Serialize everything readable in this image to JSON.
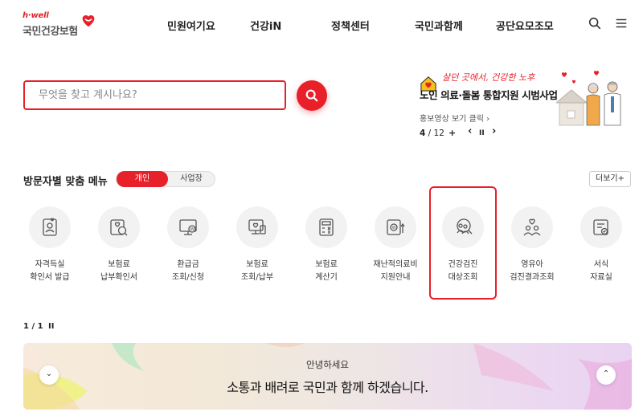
{
  "brand": {
    "sub": "h·well",
    "name": "국민건강보험",
    "accent": "#e8202a"
  },
  "nav": [
    "민원여기요",
    "건강iN",
    "정책센터",
    "국민과함께",
    "공단요모조모"
  ],
  "header_icons": [
    "search-icon",
    "menu-icon"
  ],
  "search": {
    "placeholder": "무엇을 찾고 계시나요?"
  },
  "banner": {
    "slogan": "살던 곳에서, 건강한 노후",
    "title": "노인 의료·돌봄 통합지원 시범사업",
    "link": "홍보영상 보기 클릭",
    "link_arrow": "›",
    "current": "4",
    "separator": " / ",
    "total": "12",
    "plus": "+",
    "prev": "‹",
    "pause": "II",
    "next": "›"
  },
  "menu": {
    "title": "방문자별 맞춤 메뉴",
    "toggle_on": "개인",
    "toggle_off": "사업장",
    "more": "더보기+"
  },
  "services": [
    {
      "line1": "자격득실",
      "line2": "확인서 발급",
      "icon": "id-card-icon"
    },
    {
      "line1": "보험료",
      "line2": "납부확인서",
      "icon": "payment-check-icon"
    },
    {
      "line1": "환급금",
      "line2": "조회/신청",
      "icon": "refund-monitor-icon"
    },
    {
      "line1": "보험료",
      "line2": "조회/납부",
      "icon": "pay-monitor-icon"
    },
    {
      "line1": "보험료",
      "line2": "계산기",
      "icon": "calculator-icon"
    },
    {
      "line1": "재난적의료비",
      "line2": "지원안내",
      "icon": "medical-support-icon"
    },
    {
      "line1": "건강검진",
      "line2": "대상조회",
      "icon": "checkup-people-icon"
    },
    {
      "line1": "영유아",
      "line2": "검진결과조회",
      "icon": "infant-checkup-icon"
    },
    {
      "line1": "서식",
      "line2": "자료실",
      "icon": "document-icon"
    }
  ],
  "pager": {
    "text": "1 / 1",
    "pause": "II"
  },
  "hero": {
    "greeting": "안녕하세요",
    "message": "소통과 배려로 국민과 함께 하겠습니다.",
    "left_btn": "⌄",
    "right_btn": "⌃"
  }
}
